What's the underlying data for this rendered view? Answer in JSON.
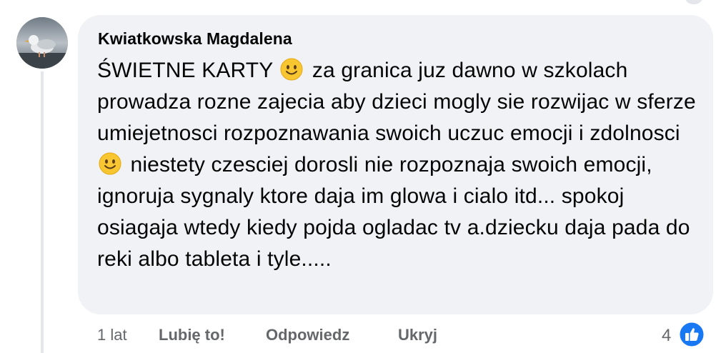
{
  "comment": {
    "author": "Kwiatkowska Magdalena",
    "text_segments": [
      "ŚWIETNE KARTY ",
      " za granica juz dawno w szkolach prowadza rozne zajecia aby dzieci mogly sie rozwijac w sferze umiejetnosci rozpoznawania swoich uczuc emocji i zdolnosci ",
      " niestety czesciej dorosli nie rozpoznaja swoich emocji, ignoruja sygnaly ktore daja im glowa i cialo itd... spokoj osiagaja wtedy kiedy pojda ogladac tv a.dziecku daja pada do reki albo tableta i tyle....."
    ],
    "emoji_icon": "slightly-smiling-face-icon"
  },
  "actions": {
    "time": "1 lat",
    "like_label": "Lubię to!",
    "reply_label": "Odpowiedz",
    "hide_label": "Ukryj"
  },
  "reactions": {
    "count": "4",
    "icon": "like-reaction-icon"
  },
  "colors": {
    "bubble_bg": "#f0f2f5",
    "text": "#050505",
    "secondary_text": "#65676b",
    "like_blue": "#1877f2"
  }
}
